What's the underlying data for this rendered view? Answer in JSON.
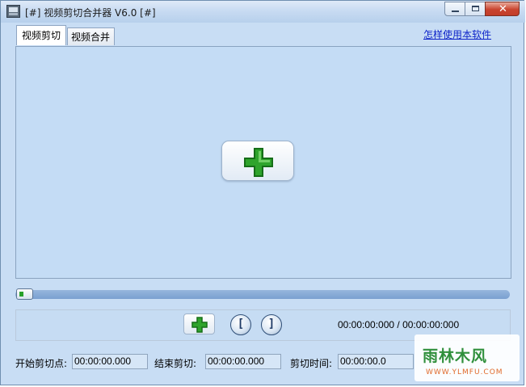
{
  "window": {
    "title": "[#] 视频剪切合并器 V6.0 [#]",
    "icon": "video-film-icon",
    "close_glyph": "✕"
  },
  "tabs": [
    {
      "label": "视频剪切",
      "active": true
    },
    {
      "label": "视频合并",
      "active": false
    }
  ],
  "help_link": "怎样使用本软件",
  "preview": {
    "add_button_icon": "plus-icon",
    "accent": "#2fa42c"
  },
  "progress": {
    "value": 0
  },
  "controls": {
    "add_icon": "plus-icon",
    "mark_start_glyph": "[",
    "mark_end_glyph": "]",
    "time_display": "00:00:00:000 / 00:00:00:000"
  },
  "fields": {
    "start_label": "开始剪切点:",
    "start_value": "00:00:00.000",
    "end_label": "结束剪切:",
    "end_value": "00:00:00.000",
    "duration_label": "剪切时间:",
    "duration_value": "00:00:00.0"
  },
  "watermark": {
    "title": "雨林木风",
    "url": "WWW.YLMFU.COM"
  }
}
